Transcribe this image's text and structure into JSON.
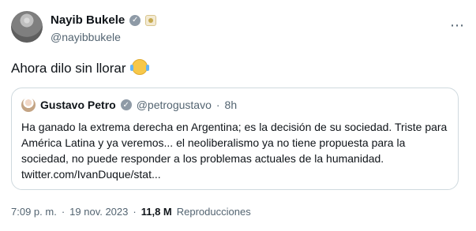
{
  "user": {
    "name": "Nayib Bukele",
    "handle": "@nayibbukele",
    "verified_icon": "verified-badge-icon",
    "affiliation_icon": "government-badge-icon"
  },
  "tweet": {
    "text": "Ahora dilo sin llorar",
    "emoji": "face-with-tears-of-joy"
  },
  "quoted": {
    "name": "Gustavo Petro",
    "handle": "@petrogustavo",
    "time": "8h",
    "text": "Ha ganado la extrema derecha en Argentina; es la decisión de su sociedad. Triste para América Latina y ya veremos... el neoliberalismo ya no tiene propuesta para la sociedad, no puede responder a los problemas actuales de la humanidad. twitter.com/IvanDuque/stat..."
  },
  "footer": {
    "time": "7:09 p. m.",
    "date": "19 nov. 2023",
    "views": "11,8 M",
    "views_label": "Reproducciones"
  },
  "ui": {
    "more_icon": "more-icon",
    "separator": "·"
  }
}
